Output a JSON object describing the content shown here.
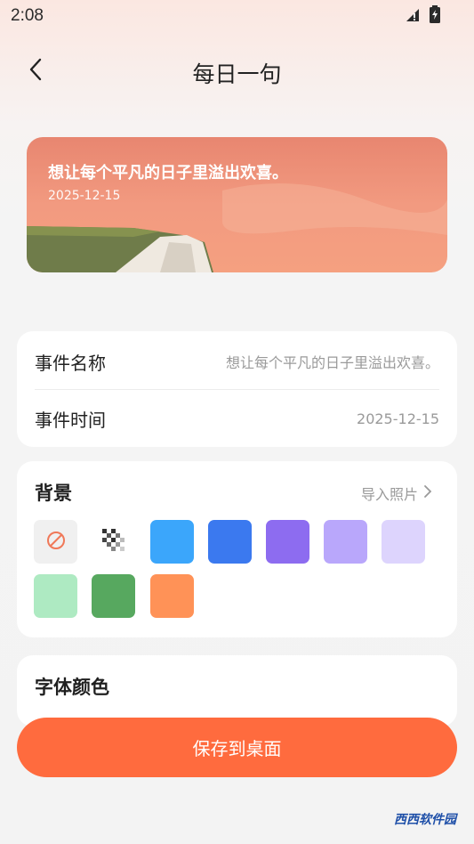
{
  "status_bar": {
    "time": "2:08"
  },
  "nav": {
    "title": "每日一句"
  },
  "preview": {
    "quote": "想让每个平凡的日子里溢出欢喜。",
    "date": "2025-12-15"
  },
  "event": {
    "name_label": "事件名称",
    "name_value": "想让每个平凡的日子里溢出欢喜。",
    "time_label": "事件时间",
    "time_value": "2025-12-15"
  },
  "background": {
    "title": "背景",
    "import_label": "导入照片",
    "swatches": [
      "none",
      "transparent",
      "#3ba6fb",
      "#3b79ef",
      "#8d6cf0",
      "#b9a7fb",
      "#ddd4fd",
      "#aeeac2",
      "#57a85f",
      "#ff9257"
    ]
  },
  "font_color": {
    "title": "字体颜色"
  },
  "save_button": {
    "label": "保存到桌面"
  },
  "watermark": {
    "text": "西西软件园"
  }
}
